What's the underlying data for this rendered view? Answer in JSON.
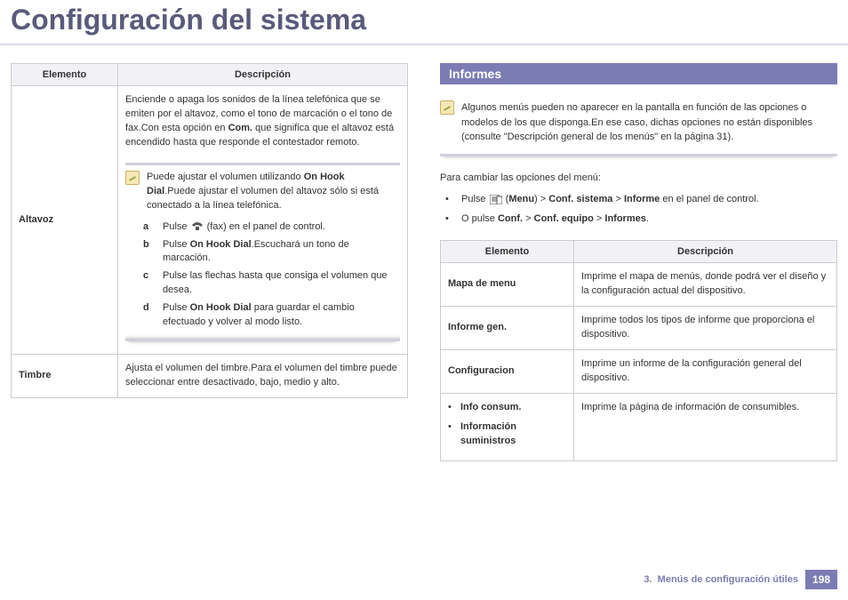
{
  "title": "Configuración del sistema",
  "left_table": {
    "headers": [
      "Elemento",
      "Descripción"
    ],
    "rows": [
      {
        "element": "Altavoz",
        "desc_intro": "Enciende o apaga los sonidos de la línea telefónica que se emiten por el altavoz, como el tono de marcación o el tono de fax.Con esta opción en ",
        "desc_bold": "Com.",
        "desc_outro": " que significa que el altavoz está encendido hasta que responde el contestador remoto.",
        "note_text1": "Puede ajustar el volumen utilizando ",
        "note_bold": "On Hook Dial",
        "note_text2": ".Puede ajustar el volumen del altavoz sólo si está conectado a la línea telefónica.",
        "steps": [
          {
            "marker": "a",
            "text_pre": "Pulse ",
            "icon": true,
            "text_post": " (fax) en el panel de control."
          },
          {
            "marker": "b",
            "text_pre": "Pulse ",
            "bold": "On Hook Dial",
            "text_post": ".Escuchará un tono de marcación."
          },
          {
            "marker": "c",
            "text_pre": "Pulse las flechas hasta que consiga el volumen que desea."
          },
          {
            "marker": "d",
            "text_pre": "Pulse ",
            "bold": "On Hook Dial",
            "text_post": " para guardar el cambio efectuado y volver al modo listo."
          }
        ]
      },
      {
        "element": "Timbre",
        "desc": "Ajusta el volumen del timbre.Para el volumen del timbre puede seleccionar entre desactivado, bajo, medio y alto."
      }
    ]
  },
  "right": {
    "section_title": "Informes",
    "note": "Algunos menús pueden no aparecer en la pantalla en función de las opciones o modelos de los que disponga.En ese caso, dichas opciones no están disponibles (consulte \"Descripción general de los menús\" en la página 31).",
    "intro": "Para cambiar las opciones del menú:",
    "bullets": [
      {
        "pre": "Pulse ",
        "icon": true,
        "mid1": " (",
        "b1": "Menu",
        "mid2": ") > ",
        "b2": "Conf. sistema",
        "mid3": " > ",
        "b3": "Informe",
        "post": " en el panel de control."
      },
      {
        "pre": "O pulse ",
        "b1": "Conf.",
        "mid2": " > ",
        "b2": "Conf. equipo",
        "mid3": " > ",
        "b3": "Informes",
        "post": "."
      }
    ],
    "table": {
      "headers": [
        "Elemento",
        "Descripción"
      ],
      "rows": [
        {
          "element": "Mapa de menu",
          "desc": "Imprime el mapa de menús, donde podrá ver el diseño y la configuración actual del dispositivo."
        },
        {
          "element": "Informe gen.",
          "desc": "Imprime todos los tipos de informe que proporciona el dispositivo."
        },
        {
          "element": "Configuracion",
          "desc": "Imprime un informe de la configuración general del dispositivo."
        },
        {
          "element_items": [
            "Info consum.",
            "Información suministros"
          ],
          "desc": "Imprime la página de información de consumibles."
        }
      ]
    }
  },
  "footer": {
    "section_no": "3.",
    "section_label": "Menús de configuración útiles",
    "page_no": "198"
  }
}
